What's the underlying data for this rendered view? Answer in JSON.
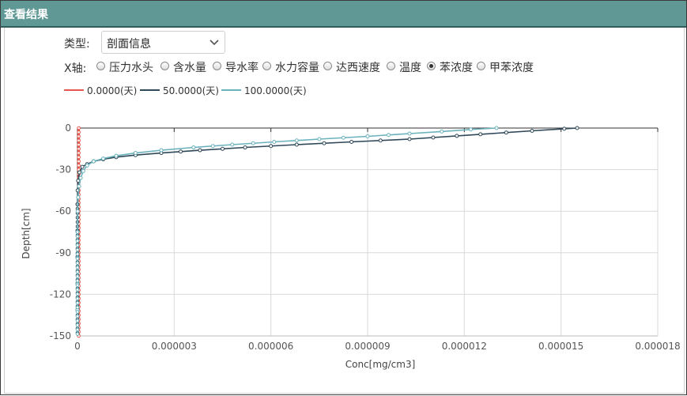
{
  "window": {
    "title": "查看结果"
  },
  "controls": {
    "type_label": "类型:",
    "type_value": "剖面信息",
    "x_axis_label": "X轴:",
    "x_options": [
      {
        "label": "压力水头",
        "selected": false
      },
      {
        "label": "含水量",
        "selected": false
      },
      {
        "label": "导水率",
        "selected": false
      },
      {
        "label": "水力容量",
        "selected": false
      },
      {
        "label": "达西速度",
        "selected": false
      },
      {
        "label": "温度",
        "selected": false
      },
      {
        "label": "苯浓度",
        "selected": true
      },
      {
        "label": "甲苯浓度",
        "selected": false
      }
    ]
  },
  "colors": {
    "titlebar": "#5f9894",
    "series": [
      "#e8574d",
      "#2f4858",
      "#6cb2bd"
    ],
    "grid": "#d9d9d9"
  },
  "chart_data": {
    "type": "line",
    "xlabel": "Conc[mg/cm3]",
    "ylabel": "Depth[cm]",
    "xlim": [
      0,
      1.8e-05
    ],
    "ylim": [
      -150,
      0
    ],
    "x_ticks": [
      "0",
      "0.000003",
      "0.000006",
      "0.000009",
      "0.000012",
      "0.000015",
      "0.000018"
    ],
    "y_ticks": [
      "0",
      "-30",
      "-60",
      "-90",
      "-120",
      "-150"
    ],
    "grid": true,
    "legend_position": "top-left",
    "series": [
      {
        "name": "0.0000(天)",
        "points": [
          [
            4e-08,
            0
          ],
          [
            4e-08,
            -150
          ]
        ]
      },
      {
        "name": "50.0000(天)",
        "points": [
          [
            1.55e-05,
            0
          ],
          [
            1.51e-05,
            -0.5
          ],
          [
            1.41e-05,
            -2
          ],
          [
            1.25e-05,
            -4.5
          ],
          [
            1.03e-05,
            -8
          ],
          [
            8.5e-06,
            -10
          ],
          [
            6.8e-06,
            -12
          ],
          [
            5.2e-06,
            -14
          ],
          [
            3.8e-06,
            -16
          ],
          [
            2.6e-06,
            -18
          ],
          [
            1.8e-06,
            -19.5
          ],
          [
            1.2e-06,
            -21
          ],
          [
            8e-07,
            -22.5
          ],
          [
            5e-07,
            -24
          ],
          [
            3e-07,
            -26
          ],
          [
            1.5e-07,
            -28
          ],
          [
            6e-08,
            -32
          ],
          [
            2e-08,
            -38
          ],
          [
            5e-09,
            -45
          ],
          [
            0,
            -55
          ],
          [
            0,
            -150
          ]
        ]
      },
      {
        "name": "100.0000(天)",
        "points": [
          [
            1.3e-05,
            0
          ],
          [
            1.22e-05,
            -1
          ],
          [
            1.13e-05,
            -2.5
          ],
          [
            1.03e-05,
            -4
          ],
          [
            9e-06,
            -6
          ],
          [
            7.5e-06,
            -8
          ],
          [
            6.1e-06,
            -10
          ],
          [
            4.8e-06,
            -12
          ],
          [
            3.6e-06,
            -14
          ],
          [
            2.6e-06,
            -16
          ],
          [
            1.8e-06,
            -18
          ],
          [
            1.2e-06,
            -20
          ],
          [
            8e-07,
            -22
          ],
          [
            5e-07,
            -24
          ],
          [
            3e-07,
            -27
          ],
          [
            1.8e-07,
            -31
          ],
          [
            1e-07,
            -36
          ],
          [
            5e-08,
            -42
          ],
          [
            2e-08,
            -50
          ],
          [
            5e-09,
            -60
          ],
          [
            0,
            -75
          ],
          [
            0,
            -150
          ]
        ]
      }
    ]
  }
}
